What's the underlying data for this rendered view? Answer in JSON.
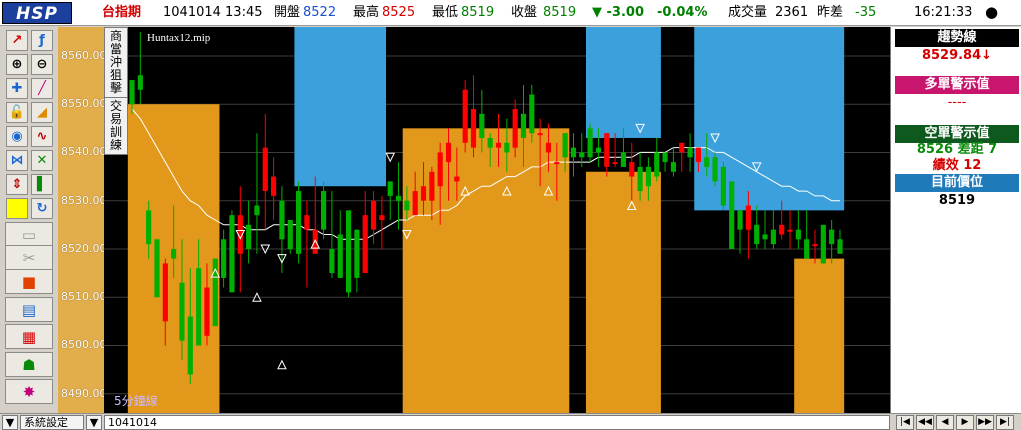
{
  "header": {
    "logo": "HSP",
    "symbol": "台指期",
    "date_time": "1041014  13:45",
    "open_label": "開盤",
    "open": "8522",
    "high_label": "最高",
    "high": "8525",
    "low_label": "最低",
    "low": "8519",
    "close_label": "收盤",
    "close": "8519",
    "change": "▼ -3.00",
    "change_pct": "-0.04%",
    "volume_label": "成交量",
    "volume": "2361",
    "diff_label": "昨差",
    "diff": "-35",
    "clock": "16:21:33",
    "close_symbol": "●"
  },
  "side_tabs": {
    "tab1": "商 當沖狙擊",
    "tab2": "交易訓練"
  },
  "right_panel": {
    "trend_title": "趨勢線",
    "trend_value": "8529.84↓",
    "long_title": "多單警示值",
    "long_value": "----",
    "short_title": "空單警示值",
    "short_value": "8526  差距 7",
    "perf": "績效 12",
    "position_title": "目前價位",
    "position_value": "8519"
  },
  "bottom": {
    "settings": "系統設定",
    "date": "1041014",
    "nav": [
      "|◀",
      "◀◀",
      "◀",
      "▶",
      "▶▶",
      "▶|"
    ]
  },
  "colors": {
    "up": "#ff0000",
    "down": "#00b000",
    "blue_band": "#3ba0dc",
    "orange_band": "#e2981b",
    "bg": "#000000",
    "grid": "#3c3c3c",
    "trend": "#ffffff"
  },
  "chart_data": {
    "type": "candlestick",
    "chart_name": "Huntax12.mip",
    "interval_label": "5分鐘線",
    "ylim": [
      8486,
      8566
    ],
    "y_ticks": [
      8490,
      8500,
      8510,
      8520,
      8530,
      8540,
      8550,
      8560
    ],
    "grid": true,
    "candles": [
      [
        8555,
        8555,
        8548,
        8550
      ],
      [
        8556,
        8565,
        8550,
        8553
      ],
      [
        8528,
        8530,
        8518,
        8521
      ],
      [
        8522,
        8522,
        8510,
        8510
      ],
      [
        8505,
        8518,
        8500,
        8517
      ],
      [
        8520,
        8529,
        8514,
        8518
      ],
      [
        8513,
        8522,
        8497,
        8501
      ],
      [
        8506,
        8516,
        8492,
        8494
      ],
      [
        8516,
        8522,
        8500,
        8500
      ],
      [
        8502,
        8517,
        8500,
        8512
      ],
      [
        8518,
        8518,
        8504,
        8504
      ],
      [
        8522,
        8524,
        8512,
        8514
      ],
      [
        8527,
        8528,
        8511,
        8511
      ],
      [
        8519,
        8533,
        8511,
        8527
      ],
      [
        8525,
        8530,
        8517,
        8520
      ],
      [
        8529,
        8544,
        8519,
        8527
      ],
      [
        8532,
        8548,
        8524,
        8541
      ],
      [
        8531,
        8539,
        8526,
        8535
      ],
      [
        8530,
        8533,
        8515,
        8522
      ],
      [
        8526,
        8526,
        8519,
        8520
      ],
      [
        8532,
        8534,
        8517,
        8519
      ],
      [
        8524,
        8530,
        8512,
        8527
      ],
      [
        8519,
        8535,
        8519,
        8524
      ],
      [
        8532,
        8534,
        8522,
        8524
      ],
      [
        8520,
        8532,
        8514,
        8515
      ],
      [
        8523,
        8528,
        8514,
        8514
      ],
      [
        8528,
        8528,
        8510,
        8511
      ],
      [
        8524,
        8524,
        8511,
        8514
      ],
      [
        8515,
        8532,
        8515,
        8527
      ],
      [
        8524,
        8532,
        8521,
        8530
      ],
      [
        8526,
        8531,
        8520,
        8527
      ],
      [
        8534,
        8534,
        8526,
        8531
      ],
      [
        8531,
        8538,
        8524,
        8530
      ],
      [
        8530,
        8533,
        8526,
        8528
      ],
      [
        8527,
        8536,
        8527,
        8532
      ],
      [
        8530,
        8538,
        8527,
        8533
      ],
      [
        8530,
        8537,
        8526,
        8536
      ],
      [
        8533,
        8542,
        8525,
        8540
      ],
      [
        8538,
        8545,
        8530,
        8542
      ],
      [
        8534,
        8541,
        8530,
        8535
      ],
      [
        8542,
        8555,
        8540,
        8553
      ],
      [
        8541,
        8556,
        8539,
        8549
      ],
      [
        8548,
        8553,
        8540,
        8543
      ],
      [
        8543,
        8544,
        8537,
        8541
      ],
      [
        8541,
        8548,
        8537,
        8542
      ],
      [
        8542,
        8547,
        8536,
        8540
      ],
      [
        8541,
        8551,
        8539,
        8549
      ],
      [
        8548,
        8554,
        8537,
        8543
      ],
      [
        8552,
        8554,
        8542,
        8544
      ],
      [
        8544,
        8547,
        8533,
        8544
      ],
      [
        8540,
        8546,
        8536,
        8542
      ],
      [
        8538,
        8542,
        8530,
        8538
      ],
      [
        8544,
        8544,
        8536,
        8539
      ],
      [
        8541,
        8544,
        8535,
        8539
      ],
      [
        8540,
        8544,
        8537,
        8539
      ],
      [
        8545,
        8546,
        8538,
        8539
      ],
      [
        8541,
        8545,
        8537,
        8540
      ],
      [
        8537,
        8544,
        8535,
        8544
      ],
      [
        8538,
        8544,
        8537,
        8538
      ],
      [
        8540,
        8545,
        8537,
        8537
      ],
      [
        8535,
        8542,
        8530,
        8538
      ],
      [
        8537,
        8540,
        8530,
        8532
      ],
      [
        8537,
        8539,
        8530,
        8533
      ],
      [
        8540,
        8543,
        8534,
        8535
      ],
      [
        8540,
        8540,
        8536,
        8538
      ],
      [
        8538,
        8541,
        8535,
        8536
      ],
      [
        8540,
        8542,
        8536,
        8542
      ],
      [
        8541,
        8544,
        8536,
        8539
      ],
      [
        8538,
        8541,
        8536,
        8541
      ],
      [
        8539,
        8544,
        8535,
        8537
      ],
      [
        8539,
        8540,
        8533,
        8534
      ],
      [
        8537,
        8538,
        8528,
        8529
      ],
      [
        8534,
        8534,
        8520,
        8520
      ],
      [
        8528,
        8528,
        8519,
        8524
      ],
      [
        8524,
        8532,
        8518,
        8529
      ],
      [
        8525,
        8529,
        8520,
        8521
      ],
      [
        8523,
        8528,
        8520,
        8522
      ],
      [
        8524,
        8528,
        8520,
        8521
      ],
      [
        8523,
        8530,
        8522,
        8525
      ],
      [
        8524,
        8528,
        8520,
        8524
      ],
      [
        8524,
        8528,
        8520,
        8522
      ],
      [
        8522,
        8528,
        8518,
        8518
      ],
      [
        8521,
        8524,
        8517,
        8521
      ],
      [
        8525,
        8525,
        8517,
        8517
      ],
      [
        8524,
        8526,
        8517,
        8521
      ],
      [
        8522,
        8524,
        8519,
        8519
      ]
    ],
    "trend_line": [
      8549,
      8547,
      8544,
      8541,
      8538,
      8535,
      8532,
      8530,
      8529,
      8527,
      8526,
      8525,
      8525,
      8525,
      8524,
      8524,
      8524,
      8525,
      8525,
      8525,
      8525,
      8524,
      8524,
      8523,
      8523,
      8522,
      8522,
      8522,
      8522,
      8523,
      8524,
      8525,
      8526,
      8526,
      8527,
      8527,
      8527,
      8528,
      8528,
      8529,
      8531,
      8532,
      8533,
      8533,
      8534,
      8535,
      8535,
      8536,
      8537,
      8537,
      8538,
      8538,
      8538,
      8538,
      8538,
      8538,
      8539,
      8539,
      8539,
      8539,
      8539,
      8540,
      8540,
      8540,
      8540,
      8541,
      8541,
      8541,
      8541,
      8541,
      8540,
      8540,
      8539,
      8538,
      8537,
      8536,
      8535,
      8534,
      8533,
      8533,
      8532,
      8532,
      8531,
      8531,
      8530,
      8530
    ],
    "blue_band": [
      [
        20,
        30,
        8533
      ],
      [
        55,
        63,
        8543
      ],
      [
        68,
        85,
        8528
      ]
    ],
    "orange_band": [
      [
        0,
        10,
        8550
      ],
      [
        33,
        52,
        8545
      ],
      [
        55,
        63,
        8536
      ],
      [
        80,
        85,
        8518
      ]
    ],
    "buy_arrows": [
      [
        10,
        8515
      ],
      [
        15,
        8510
      ],
      [
        18,
        8496
      ],
      [
        22,
        8521
      ],
      [
        40,
        8532
      ],
      [
        45,
        8532
      ],
      [
        50,
        8532
      ],
      [
        60,
        8529
      ]
    ],
    "sell_arrows": [
      [
        13,
        8523
      ],
      [
        16,
        8520
      ],
      [
        18,
        8518
      ],
      [
        31,
        8539
      ],
      [
        33,
        8523
      ],
      [
        61,
        8545
      ],
      [
        70,
        8543
      ],
      [
        75,
        8537
      ]
    ]
  }
}
